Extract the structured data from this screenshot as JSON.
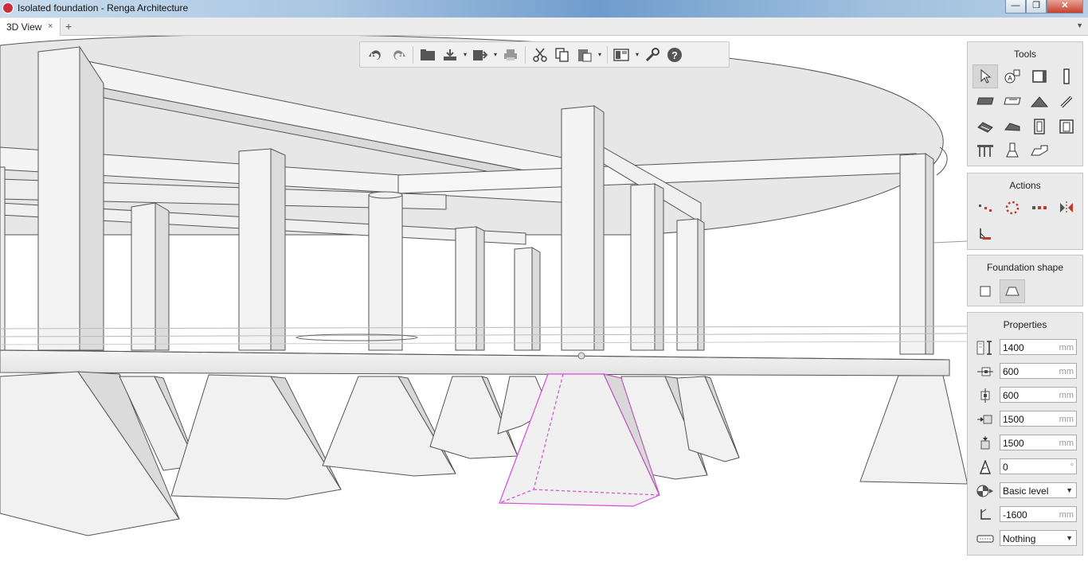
{
  "window": {
    "title": "Isolated foundation - Renga Architecture",
    "minimize": "—",
    "maximize": "❐",
    "close": "✕"
  },
  "tabs": {
    "items": [
      {
        "label": "3D View",
        "close": "×"
      }
    ],
    "add": "+",
    "menu": "▼"
  },
  "toolbar": {
    "icons": [
      "undo-icon",
      "redo-icon",
      "open-icon",
      "import-icon",
      "export-icon",
      "print-icon",
      "cut-icon",
      "copy-icon",
      "paste-icon",
      "view-mode-icon",
      "settings-icon",
      "help-icon"
    ],
    "dropdown_glyph": "▾"
  },
  "tools_panel": {
    "title": "Tools",
    "icons": [
      "select-icon",
      "level-icon",
      "wall-icon",
      "column-icon",
      "floor-icon",
      "slab-icon",
      "roof-icon",
      "beam-icon",
      "stairs-icon",
      "ramp-icon",
      "door-icon",
      "window-icon",
      "railing-icon",
      "isolated-foundation-icon",
      "wall-foundation-icon"
    ]
  },
  "actions_panel": {
    "title": "Actions",
    "icons": [
      "linear-array-icon",
      "circular-array-icon",
      "copy-array-icon",
      "mirror-icon",
      "set-base-icon"
    ]
  },
  "foundation_shape_panel": {
    "title": "Foundation shape",
    "options": [
      "rectangle-shape-icon",
      "trapezoid-shape-icon"
    ],
    "selected": "trapezoid-shape-icon"
  },
  "properties_panel": {
    "title": "Properties",
    "rows": [
      {
        "icon": "height-icon",
        "value": "1400",
        "unit": "mm"
      },
      {
        "icon": "top-width-icon",
        "value": "600",
        "unit": "mm"
      },
      {
        "icon": "top-length-icon",
        "value": "600",
        "unit": "mm"
      },
      {
        "icon": "bottom-width-icon",
        "value": "1500",
        "unit": "mm"
      },
      {
        "icon": "bottom-length-icon",
        "value": "1500",
        "unit": "mm"
      },
      {
        "icon": "angle-icon",
        "value": "0",
        "unit": "°"
      },
      {
        "icon": "level-select-icon",
        "value": "Basic level",
        "type": "select"
      },
      {
        "icon": "offset-icon",
        "value": "-1600",
        "unit": "mm"
      },
      {
        "icon": "material-icon",
        "value": "Nothing",
        "type": "select"
      }
    ],
    "select_arrow": "▼"
  },
  "colors": {
    "selection": "#d94ad9",
    "panel_bg": "#eaeaea",
    "accent_red": "#c0392b"
  }
}
